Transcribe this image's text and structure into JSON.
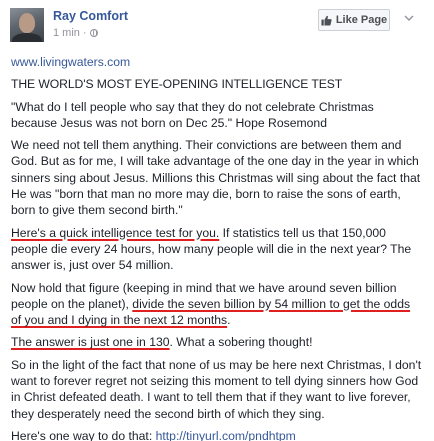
{
  "header": {
    "page_name": "Ray Comfort",
    "timestamp": "1 min",
    "separator": "·",
    "like_page_label": "Like Page",
    "avatar_icon": "profile-photo",
    "privacy_icon": "globe-icon",
    "like_icon": "thumbs-up-icon",
    "options_icon": "chevron-down-icon"
  },
  "post": {
    "link_url": "www.livingwaters.com",
    "title": "THE WORLD'S MOST EYE-OPENING INTELLIGENCE TEST",
    "p1": "\"What do I tell people who say that they do not celebrate Christmas because Jesus was not born on Dec 25.\" Hope Rosemond",
    "p2": "We need not tell them anything. Their convictions are between them and God. But as for me, I will take advantage of the one day in the year in which sinners sing about Jesus. Millions this Christmas will sing about the fact that He was \"born that man no more may die, born to raise the sons of earth, born to give them second birth.\"",
    "p3_highlight": "Here's a quick intelligence test for you.",
    "p3_rest": " If statistics tell us that 150,000 people die every 24 hours, how many people will die in the next year? The answer is, just over 54 million.",
    "p4_start": "Now hold that figure (keeping in mind that we have around seven billion people on the planet), ",
    "p4_highlight": "divide the seven billion by 54 million to get the odds of you and I dying in the next 12 months",
    "p4_end": ".",
    "p5_highlight": "The answer is just one in 130",
    "p5_rest": ". What a sobering thought!",
    "p6": "So in the light of the fact that none of us may be here next Christmas, I don't want to forever regret not seizing this moment to tell dying sinners how God in Christ defeated death. I want to tell them that if they want to live forever, they desperately need the second birth of which they sing.",
    "p7_start": "Here's one way to do that: ",
    "p7_link": "http://tinyurl.com/pndhtpm"
  },
  "colors": {
    "link": "#365899",
    "text": "#1d2129",
    "meta": "#90949c",
    "underline_highlight": "#e02020"
  }
}
